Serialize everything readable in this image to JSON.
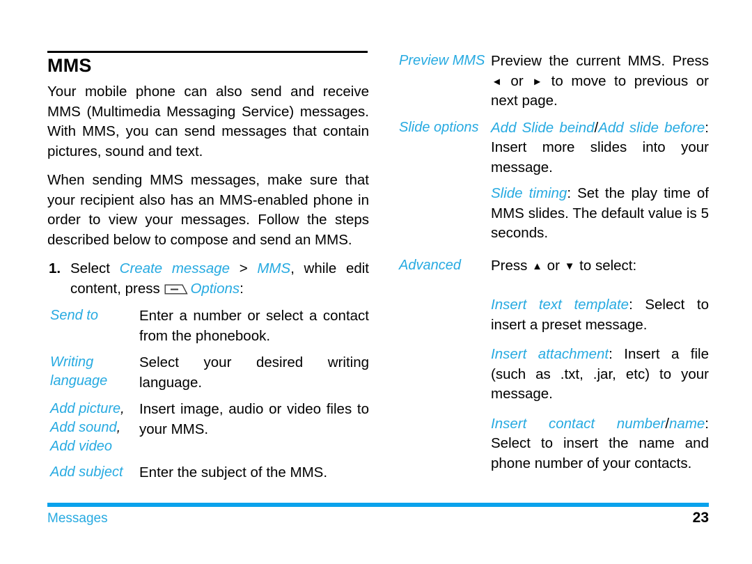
{
  "page": {
    "number": "23",
    "footer_section": "Messages",
    "accent_blue": "#27aae1",
    "rule_blue": "#0aa2ec",
    "text_black": "#000000"
  },
  "left_column": {
    "heading": "MMS",
    "paragraphs": [
      "Your mobile phone can also send and receive MMS (Multimedia Messaging Service) messages. With MMS, you can send messages that contain pictures, sound and text.",
      "When sending MMS messages, make sure that your recipient also has an MMS-enabled phone in order to view your messages. Follow the steps described below to compose and send an MMS."
    ],
    "step": {
      "marker": "1.",
      "text_1": "Select ",
      "link_1": "Create message",
      "separator": " > ",
      "link_2": "MMS",
      "text_2": ", while edit content, press ",
      "softkey_icon": "softkey-left-icon",
      "link_3": "Options",
      "text_3": ":"
    },
    "rows": [
      {
        "term": "Send to",
        "description": "Enter a number or select a contact from the phonebook."
      },
      {
        "term": "Writing language",
        "description": "Select your desired writing language."
      },
      {
        "term_parts": [
          {
            "text": "Add picture",
            "style": "blue"
          },
          {
            "text": ",",
            "style": "black"
          },
          {
            "text": "Add sound",
            "style": "blue"
          },
          {
            "text": ",",
            "style": "black"
          },
          {
            "text": "Add video",
            "style": "blue"
          }
        ],
        "term": "Add picture, Add sound, Add video",
        "description": "Insert image, audio or video files to your MMS."
      },
      {
        "term": "Add subject",
        "description": "Enter the subject of the MMS."
      }
    ]
  },
  "right_column": {
    "rows": [
      {
        "term": "Preview MMS",
        "description_prefix": "Preview the current MMS. Press ",
        "arrow_left": "◄",
        "description_middle": " or ",
        "arrow_right": "►",
        "description_suffix": " to move to previous or next page."
      },
      {
        "term": "Slide options",
        "link_a": "Add Slide beind",
        "slash": "/",
        "link_b": "Add slide before",
        "description_a": ": Insert more slides into your message.",
        "link_c": "Slide timing",
        "description_b": ": Set the play time of MMS slides. The default value is 5 seconds."
      },
      {
        "term": "Advanced",
        "description_prefix": "Press ",
        "arrow_up": "▲",
        "description_middle": " or ",
        "arrow_down": "▼",
        "description_suffix": " to select:"
      }
    ],
    "advanced_items": [
      {
        "link": "Insert text template",
        "description": ": Select to insert a preset message."
      },
      {
        "link": "Insert attachment",
        "description": ": Insert a file (such as .txt, .jar, etc) to your message."
      },
      {
        "link_a": "Insert contact number",
        "slash": "/",
        "link_b": "name",
        "description": ": Select to insert the name and phone number of your contacts."
      }
    ]
  }
}
